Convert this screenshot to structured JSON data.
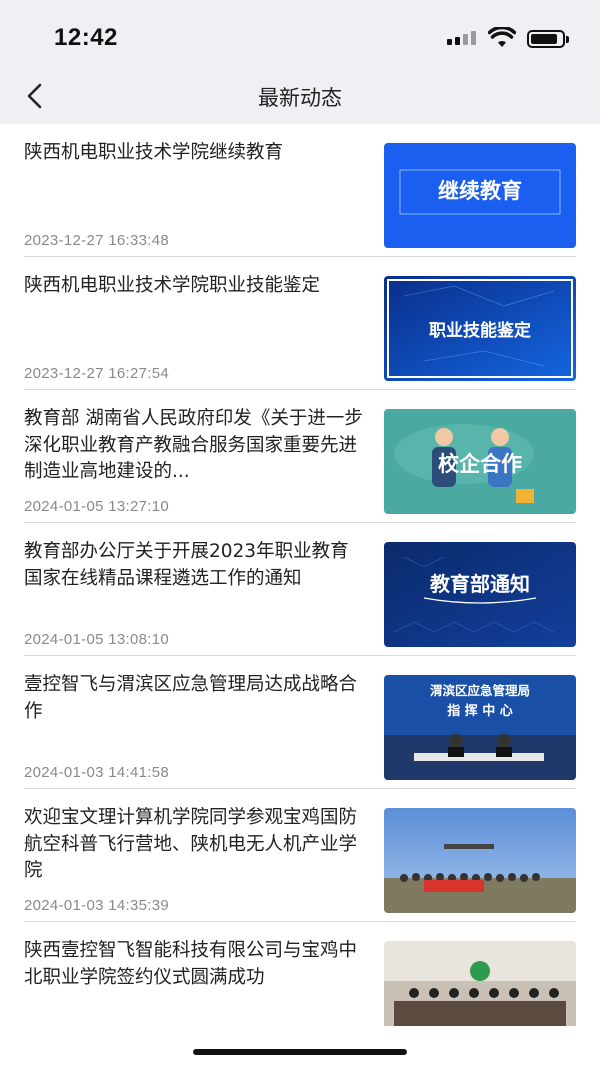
{
  "status_bar": {
    "time": "12:42",
    "battery_level": 0.85
  },
  "nav": {
    "back_icon": "chevron-left-icon",
    "title": "最新动态"
  },
  "colors": {
    "nav_bg": "#eef0f3",
    "divider": "#dcdcdc",
    "timestamp": "#8a8a8a"
  },
  "items": [
    {
      "title": "陕西机电职业技术学院继续教育",
      "time": "2023-12-27 16:33:48",
      "thumb_text": "继续教育"
    },
    {
      "title": "陕西机电职业技术学院职业技能鉴定",
      "time": "2023-12-27 16:27:54",
      "thumb_text": "职业技能鉴定"
    },
    {
      "title": "教育部 湖南省人民政府印发《关于进一步深化职业教育产教融合服务国家重要先进制造业高地建设的...",
      "time": "2024-01-05 13:27:10",
      "thumb_text": "校企合作"
    },
    {
      "title": "教育部办公厅关于开展2023年职业教育 国家在线精品课程遴选工作的通知",
      "time": "2024-01-05 13:08:10",
      "thumb_text": "教育部通知"
    },
    {
      "title": "壹控智飞与渭滨区应急管理局达成战略合作",
      "time": "2024-01-03 14:41:58",
      "thumb_text": "渭滨区应急管理局",
      "thumb_text2": "指 挥 中 心"
    },
    {
      "title": "欢迎宝文理计算机学院同学参观宝鸡国防航空科普飞行营地、陕机电无人机产业学院",
      "time": "2024-01-03 14:35:39",
      "thumb_text": ""
    },
    {
      "title": "陕西壹控智飞智能科技有限公司与宝鸡中北职业学院签约仪式圆满成功",
      "time": "",
      "thumb_text": ""
    }
  ]
}
